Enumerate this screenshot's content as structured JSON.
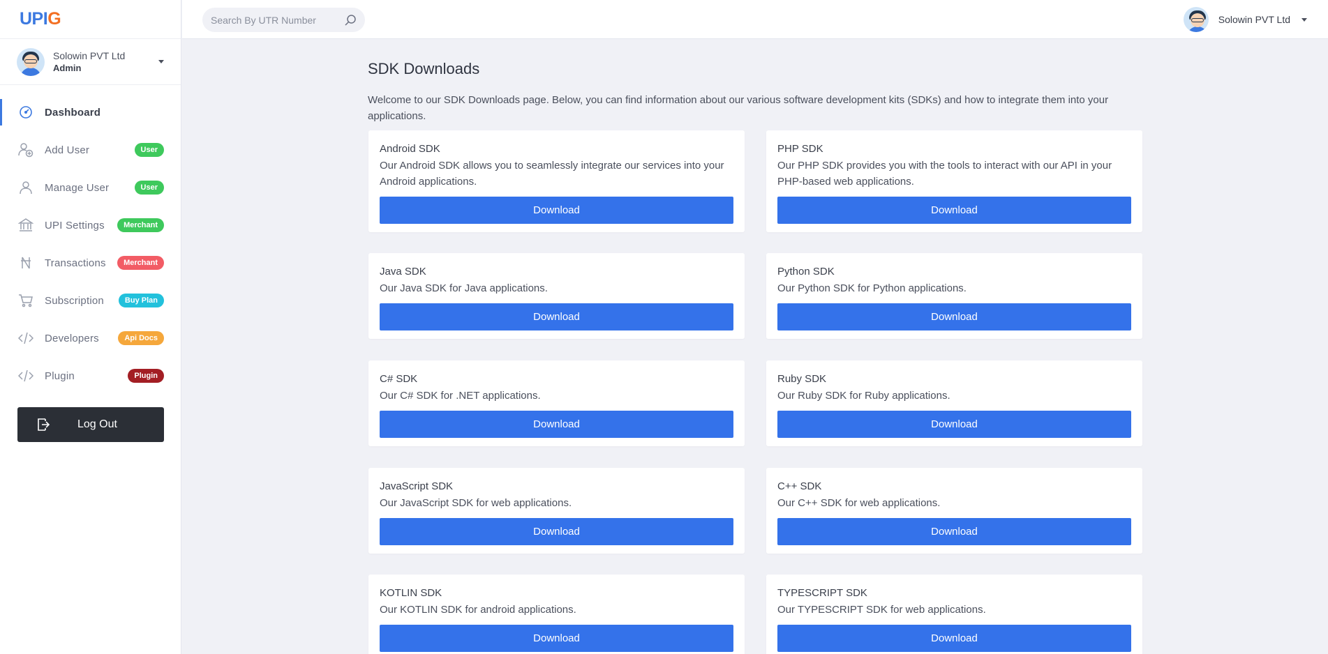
{
  "brand": {
    "logo_part1": "UPI",
    "logo_part2": "G"
  },
  "sidebar": {
    "profile": {
      "name": "Solowin PVT Ltd",
      "role": "Admin"
    },
    "items": [
      {
        "label": "Dashboard",
        "icon": "dashboard-icon",
        "badge": ""
      },
      {
        "label": "Add User",
        "icon": "add-user-icon",
        "badge": "User",
        "badge_color": "#3ec95c"
      },
      {
        "label": "Manage User",
        "icon": "user-icon",
        "badge": "User",
        "badge_color": "#3ec95c"
      },
      {
        "label": "UPI Settings",
        "icon": "bank-icon",
        "badge": "Merchant",
        "badge_color": "#3ec95c"
      },
      {
        "label": "Transactions",
        "icon": "rupee-icon",
        "badge": "Merchant",
        "badge_color": "#f25c65"
      },
      {
        "label": "Subscription",
        "icon": "cart-icon",
        "badge": "Buy Plan",
        "badge_color": "#22c1dc"
      },
      {
        "label": "Developers",
        "icon": "code-icon",
        "badge": "Api Docs",
        "badge_color": "#f5a73b"
      },
      {
        "label": "Plugin",
        "icon": "code-icon",
        "badge": "Plugin",
        "badge_color": "#a31e24"
      }
    ],
    "logout_label": "Log Out"
  },
  "header": {
    "search_placeholder": "Search By UTR Number",
    "user_name": "Solowin PVT Ltd"
  },
  "main": {
    "title": "SDK Downloads",
    "intro": "Welcome to our SDK Downloads page. Below, you can find information about our various software development kits (SDKs) and how to integrate them into your applications.",
    "cards": [
      {
        "title": "Android SDK",
        "description": "Our Android SDK allows you to seamlessly integrate our services into your Android applications.",
        "button": "Download"
      },
      {
        "title": "PHP SDK",
        "description": "Our PHP SDK provides you with the tools to interact with our API in your PHP-based web applications.",
        "button": "Download"
      },
      {
        "title": "Java SDK",
        "description": "Our Java SDK for Java applications.",
        "button": "Download"
      },
      {
        "title": "Python SDK",
        "description": "Our Python SDK for Python applications.",
        "button": "Download"
      },
      {
        "title": "C# SDK",
        "description": "Our C# SDK for .NET applications.",
        "button": "Download"
      },
      {
        "title": "Ruby SDK",
        "description": "Our Ruby SDK for Ruby applications.",
        "button": "Download"
      },
      {
        "title": "JavaScript SDK",
        "description": "Our JavaScript SDK for web applications.",
        "button": "Download"
      },
      {
        "title": "C++ SDK",
        "description": "Our C++ SDK for web applications.",
        "button": "Download"
      },
      {
        "title": "KOTLIN SDK",
        "description": "Our KOTLIN SDK for android applications.",
        "button": "Download"
      },
      {
        "title": "TYPESCRIPT SDK",
        "description": "Our TYPESCRIPT SDK for web applications.",
        "button": "Download"
      }
    ]
  },
  "colors": {
    "accent": "#3472ea",
    "brand_blue": "#3c79e0",
    "brand_orange": "#f36f22",
    "background": "#f0f1f6",
    "logout_bg": "#2b2f36"
  }
}
